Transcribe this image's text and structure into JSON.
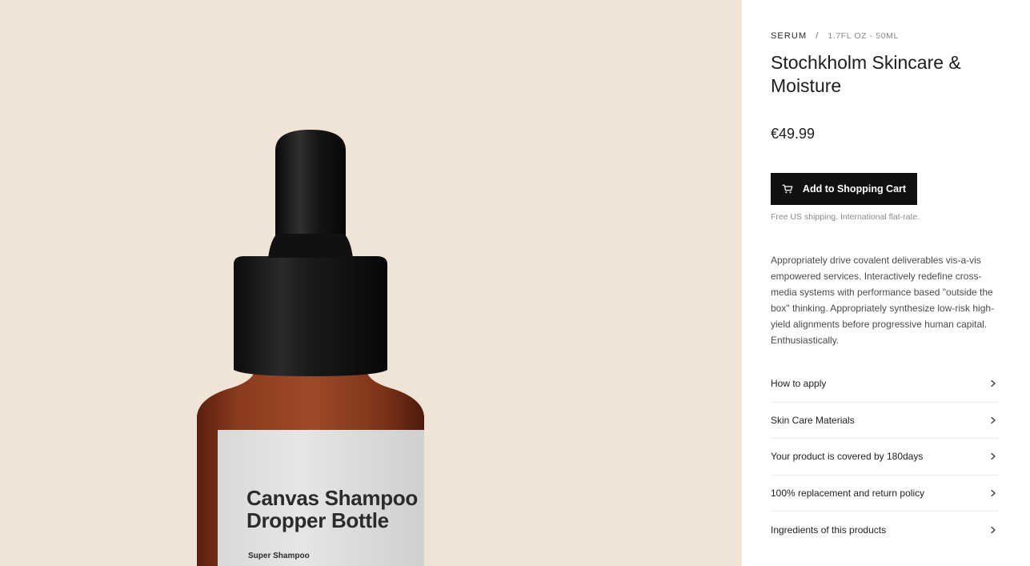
{
  "hero": {
    "label_title": "Canvas Shampoo\nDropper Bottle",
    "label_sub": "Super Shampoo",
    "background": "#efe4d5"
  },
  "product": {
    "category": "SERUM",
    "separator": "/",
    "size": "1.7FL OZ - 50ML",
    "title": "Stochkholm Skincare & Moisture",
    "price": "€49.99",
    "add_to_cart_label": "Add to Shopping Cart",
    "cart_icon": "cart-icon",
    "shipping_note": "Free US shipping. International flat-rate.",
    "description": "Appropriately drive covalent deliverables vis-a-vis empowered services. Interactively redefine cross-media systems with performance based \"outside the box\" thinking. Appropriately synthesize low-risk high-yield alignments before progressive human capital. Enthusiastically."
  },
  "accordion": [
    {
      "label": "How to apply"
    },
    {
      "label": "Skin Care Materials"
    },
    {
      "label": "Your product is covered by 180days"
    },
    {
      "label": "100% replacement and return policy"
    },
    {
      "label": "Ingredients of this products"
    }
  ],
  "colors": {
    "button": "#111111",
    "panel": "#ffffff"
  }
}
